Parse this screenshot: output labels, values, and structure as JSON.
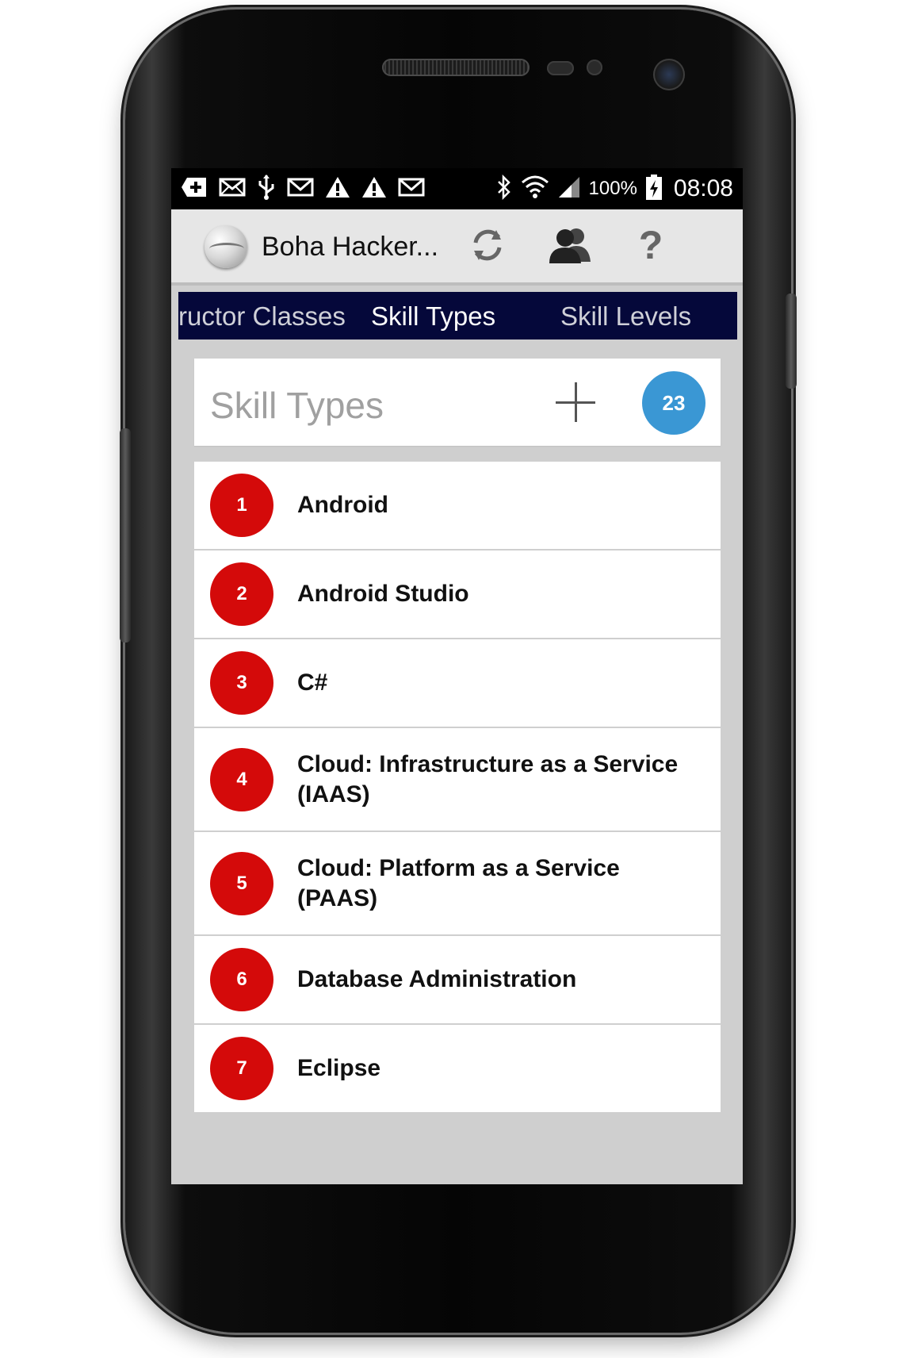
{
  "status_bar": {
    "notification_icons": [
      "add-icon",
      "mail-icon",
      "usb-icon",
      "gmail-icon",
      "warning-icon",
      "warning-icon",
      "gmail-icon"
    ],
    "battery_percent": "100%",
    "time": "08:08"
  },
  "action_bar": {
    "title": "Boha Hacker...",
    "icons": [
      "sync-icon",
      "users-icon",
      "help-icon"
    ],
    "help_glyph": "?"
  },
  "tabs": [
    {
      "label": "ructor Classes",
      "active": false
    },
    {
      "label": "Skill Types",
      "active": true
    },
    {
      "label": "Skill Levels",
      "active": false
    }
  ],
  "list_header": {
    "title": "Skill Types",
    "count": "23"
  },
  "items": [
    {
      "number": "1",
      "label": "Android"
    },
    {
      "number": "2",
      "label": "Android Studio"
    },
    {
      "number": "3",
      "label": "C#"
    },
    {
      "number": "4",
      "label": "Cloud: Infrastructure as a Service (IAAS)"
    },
    {
      "number": "5",
      "label": "Cloud: Platform as a Service (PAAS)"
    },
    {
      "number": "6",
      "label": "Database Administration"
    },
    {
      "number": "7",
      "label": "Eclipse"
    }
  ],
  "colors": {
    "tab_bar": "#05083a",
    "badge_blue": "#3a97d4",
    "number_red": "#d40a0a"
  }
}
